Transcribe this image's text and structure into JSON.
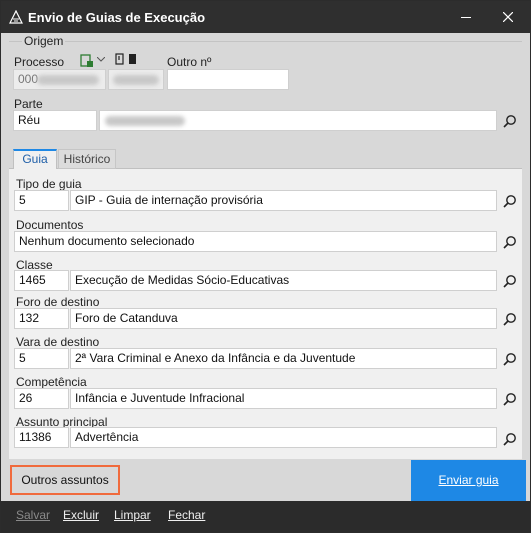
{
  "window": {
    "title": "Envio de Guias de Execução"
  },
  "origem": {
    "legend": "Origem",
    "processo_label": "Processo",
    "processo_value": "000",
    "outro_label": "Outro nº",
    "outro_value": "",
    "parte_label": "Parte",
    "parte_value": "Réu",
    "parte_name": ""
  },
  "tabs": [
    {
      "label": "Guia"
    },
    {
      "label": "Histórico"
    }
  ],
  "fields": {
    "tipo_de_guia": {
      "label": "Tipo de guia",
      "code": "5",
      "value": "GIP - Guia de internação provisória"
    },
    "documentos": {
      "label": "Documentos",
      "value": "Nenhum documento selecionado"
    },
    "classe": {
      "label": "Classe",
      "code": "1465",
      "value": "Execução de Medidas Sócio-Educativas"
    },
    "foro_de_destino": {
      "label": "Foro de destino",
      "code": "132",
      "value": "Foro de Catanduva"
    },
    "vara_de_destino": {
      "label": "Vara de destino",
      "code": "5",
      "value": "2ª Vara Criminal e Anexo da Infância e da Juventude"
    },
    "competencia": {
      "label": "Competência",
      "code": "26",
      "value": "Infância e Juventude Infracional"
    },
    "assunto_principal": {
      "label": "Assunto principal",
      "code": "11386",
      "value": "Advertência"
    }
  },
  "actions": {
    "outros_assuntos": "Outros assuntos",
    "enviar_guia": "Enviar guia"
  },
  "bottombar": {
    "salvar": "Salvar",
    "excluir": "Excluir",
    "limpar": "Limpar",
    "fechar": "Fechar"
  },
  "colors": {
    "accent": "#1e88e5",
    "highlight": "#f06a3c",
    "titlebar": "#2f2f2f"
  },
  "icons": [
    "app-icon",
    "minimize-icon",
    "close-icon",
    "document-icon",
    "chevron-down-icon",
    "bookmark-icon",
    "search-icon"
  ]
}
